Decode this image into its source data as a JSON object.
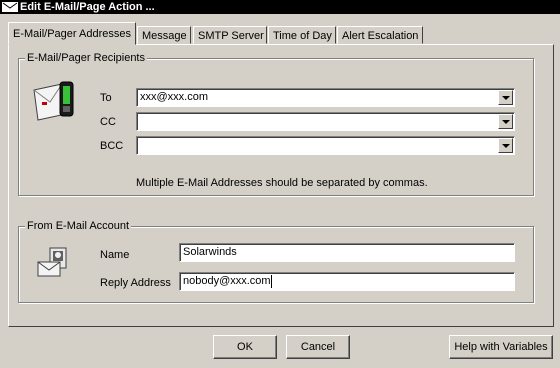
{
  "window": {
    "title": "Edit E-Mail/Page Action ..."
  },
  "tabs": [
    {
      "label": "E-Mail/Pager Addresses",
      "active": true
    },
    {
      "label": "Message",
      "active": false
    },
    {
      "label": "SMTP Server",
      "active": false
    },
    {
      "label": "Time of Day",
      "active": false
    },
    {
      "label": "Alert Escalation",
      "active": false
    }
  ],
  "recipients": {
    "legend": "E-Mail/Pager Recipients",
    "to_label": "To",
    "to_value": "xxx@xxx.com",
    "cc_label": "CC",
    "cc_value": "",
    "bcc_label": "BCC",
    "bcc_value": "",
    "note": "Multiple E-Mail Addresses should be separated by commas."
  },
  "account": {
    "legend": "From E-Mail Account",
    "name_label": "Name",
    "name_value": "Solarwinds",
    "reply_label": "Reply Address",
    "reply_value": "nobody@xxx.com"
  },
  "buttons": {
    "ok": "OK",
    "cancel": "Cancel",
    "help": "Help with Variables"
  }
}
